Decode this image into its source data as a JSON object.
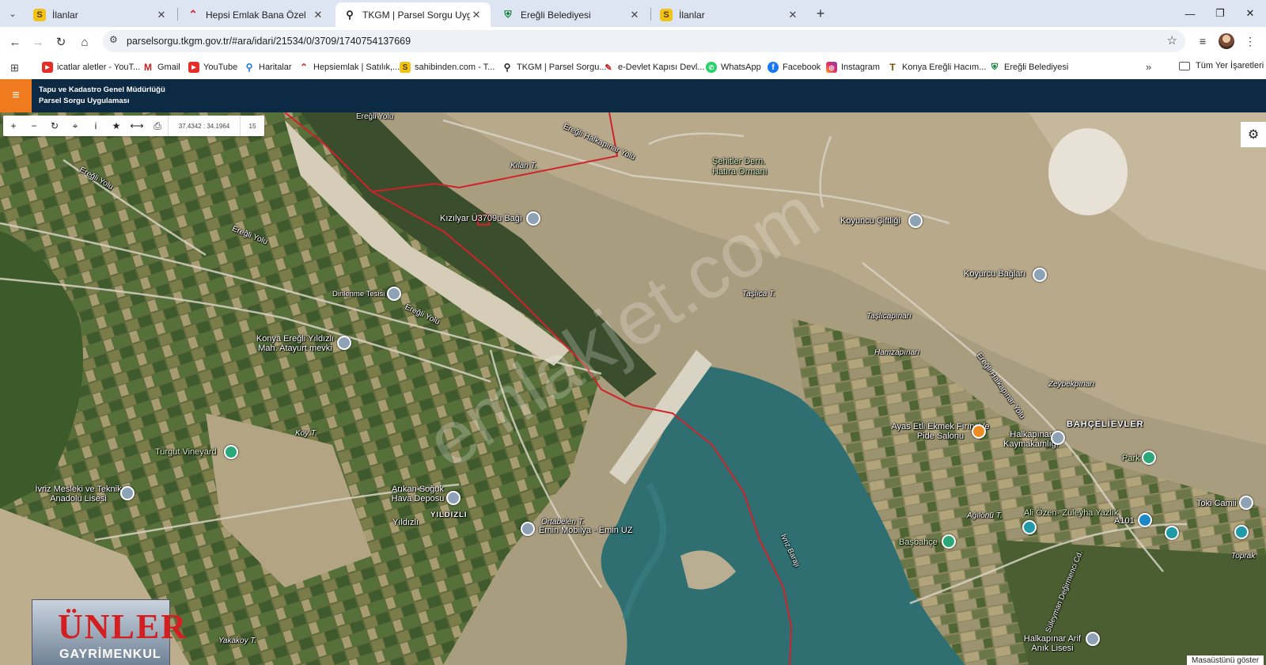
{
  "browser": {
    "tabs": [
      {
        "title": "İlanlar",
        "icon": "sahibinden-icon",
        "active": false
      },
      {
        "title": "Hepsi Emlak Bana Özel",
        "icon": "hepsiemlak-icon",
        "active": false
      },
      {
        "title": "TKGM | Parsel Sorgu Uygulama",
        "icon": "map-pin-icon",
        "active": true
      },
      {
        "title": "Ereğli Belediyesi",
        "icon": "eregli-icon",
        "active": false
      },
      {
        "title": "İlanlar",
        "icon": "sahibinden-icon",
        "active": false
      }
    ],
    "url": "parselsorgu.tkgm.gov.tr/#ara/idari/21534/0/3709/1740754137669",
    "bookmarks": [
      {
        "label": "icatlar aletler - YouT...",
        "icon": "youtube-icon"
      },
      {
        "label": "Gmail",
        "icon": "gmail-icon"
      },
      {
        "label": "YouTube",
        "icon": "youtube-icon"
      },
      {
        "label": "Haritalar",
        "icon": "maps-icon"
      },
      {
        "label": "Hepsiemlak | Satılık,...",
        "icon": "hepsiemlak-icon"
      },
      {
        "label": "sahibinden.com - T...",
        "icon": "sahibinden-icon"
      },
      {
        "label": "TKGM | Parsel Sorgu...",
        "icon": "map-pin-icon"
      },
      {
        "label": "e-Devlet Kapısı Devl...",
        "icon": "edevlet-icon"
      },
      {
        "label": "WhatsApp",
        "icon": "whatsapp-icon"
      },
      {
        "label": "Facebook",
        "icon": "facebook-icon"
      },
      {
        "label": "Instagram",
        "icon": "instagram-icon"
      },
      {
        "label": "Konya Ereğli Hacım...",
        "icon": "konya-icon"
      },
      {
        "label": "Ereğli Belediyesi",
        "icon": "eregli-icon"
      }
    ],
    "bookmarks_folder": "Tüm Yer İşaretleri"
  },
  "app": {
    "title_line1": "Tapu ve Kadastro Genel Müdürlüğü",
    "title_line2": "Parsel Sorgu Uygulaması",
    "coords": "37.4342 : 34.1964",
    "zoom": "15"
  },
  "map": {
    "labels": [
      {
        "text": "Ereğli Yolu"
      },
      {
        "text": "Ereğli Yolu"
      },
      {
        "text": "Ereğli Yolu"
      },
      {
        "text": "Ereğli Yolu"
      },
      {
        "text": "Ereğli Halkapınar Yolu"
      },
      {
        "text": "Ereğli-Halkapınar Yolu"
      },
      {
        "text": "Kılan T."
      },
      {
        "text": "Şehitler Dern. Hatıra Ormanı"
      },
      {
        "text": "Kızılyar Ü3709u Bağı"
      },
      {
        "text": "Koyuncu Çiftliği"
      },
      {
        "text": "Koyurcu Bağları"
      },
      {
        "text": "Dinlenme Tesisi"
      },
      {
        "text": "Taşlıca T."
      },
      {
        "text": "Taşlıcapınarı"
      },
      {
        "text": "Hamzapınarı"
      },
      {
        "text": "Zeybekpınarı"
      },
      {
        "text": "Konya Ereğli Yıldızlı Mah. Atayurt mevki"
      },
      {
        "text": "Koy T."
      },
      {
        "text": "Turgut Vineyard"
      },
      {
        "text": "Ayas Etli Ekmek Fırını Ve Pide Salonu"
      },
      {
        "text": "Halkapınar Kaymakamlığı"
      },
      {
        "text": "BAHÇELİEVLER"
      },
      {
        "text": "Park"
      },
      {
        "text": "İvriz Mesleki ve Teknik Anadolu Lisesi"
      },
      {
        "text": "Arıkan Soğuk Hava Deposu"
      },
      {
        "text": "YILDIZLI"
      },
      {
        "text": "Yıldızlı"
      },
      {
        "text": "Ortabelen T."
      },
      {
        "text": "Emin Mobilya - Emin UZ"
      },
      {
        "text": "Ağılönü T."
      },
      {
        "text": "Ali Özen- Züleyha Yazlık"
      },
      {
        "text": "A101"
      },
      {
        "text": "Toki Camii"
      },
      {
        "text": "Başbahçe"
      },
      {
        "text": "İvriz Barajı"
      },
      {
        "text": "Süleyman Değirmenci Cd."
      },
      {
        "text": "Yakakoy T."
      },
      {
        "text": "Halkapınar Arif Anık Lisesi"
      },
      {
        "text": "Toprak"
      }
    ],
    "watermark": "emlakjet.com",
    "logo_line1": "ÜNLER",
    "logo_line2": "GAYRİMENKUL",
    "show_desktop": "Masaüstünü göster"
  },
  "colors": {
    "tabstrip": "#dee5f2",
    "header": "#0d2a44",
    "accent": "#f07b1f",
    "parcel_line": "#d0222a",
    "lake": "#2f6f72"
  }
}
